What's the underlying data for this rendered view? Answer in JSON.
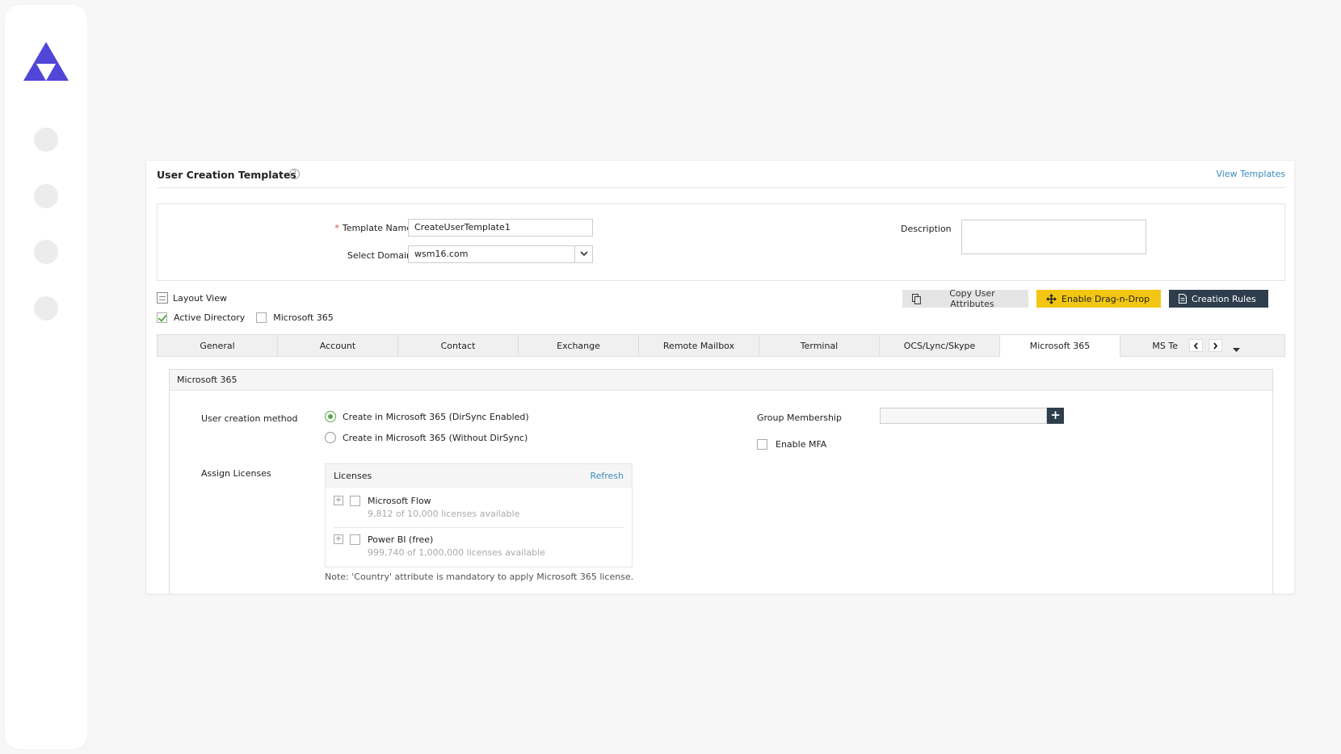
{
  "brand": {
    "accent": "#5046d8",
    "logo": "triangle-logo-icon"
  },
  "sidebar": {
    "icons": [
      "nav-dot",
      "nav-dot",
      "nav-dot",
      "nav-dot"
    ]
  },
  "header": {
    "title": "User Creation Templates",
    "help": "?",
    "view_templates": "View Templates"
  },
  "form": {
    "template_name_label": "Template Name",
    "required_mark": "*",
    "template_name_value": "CreateUserTemplate1",
    "select_domain_label": "Select Domain",
    "select_domain_value": "wsm16.com",
    "description_label": "Description",
    "description_value": ""
  },
  "toolbar": {
    "layout_view": "Layout View",
    "copy_attributes": "Copy User Attributes",
    "enable_drag": "Enable Drag-n-Drop",
    "creation_rules": "Creation Rules",
    "checkboxes": [
      {
        "label": "Active Directory",
        "checked": true
      },
      {
        "label": "Microsoft 365",
        "checked": false
      }
    ]
  },
  "tabs": [
    {
      "label": "General"
    },
    {
      "label": "Account"
    },
    {
      "label": "Contact"
    },
    {
      "label": "Exchange"
    },
    {
      "label": "Remote Mailbox"
    },
    {
      "label": "Terminal"
    },
    {
      "label": "OCS/Lync/Skype"
    },
    {
      "label": "Microsoft 365",
      "active": true
    },
    {
      "label": "MS Te"
    }
  ],
  "section": {
    "title": "Microsoft 365",
    "creation_method_label": "User creation method",
    "radio_dirsync": "Create in Microsoft 365 (DirSync Enabled)",
    "radio_nodirsync": "Create in Microsoft 365 (Without DirSync)",
    "group_membership_label": "Group Membership",
    "group_add": "+",
    "enable_mfa": "Enable MFA",
    "assign_licenses_label": "Assign Licenses",
    "licenses_title": "Licenses",
    "refresh": "Refresh",
    "licenses": [
      {
        "name": "Microsoft Flow",
        "available": "9,812 of 10,000 licenses available"
      },
      {
        "name": "Power BI (free)",
        "available": "999,740 of 1,000,000 licenses available"
      }
    ],
    "note": "Note: 'Country' attribute is mandatory to apply Microsoft 365 license."
  },
  "colors": {
    "link": "#3b8dc0",
    "drag_button": "#f2c612",
    "dark_button": "#2e3e4c",
    "check_green": "#59a84a"
  }
}
